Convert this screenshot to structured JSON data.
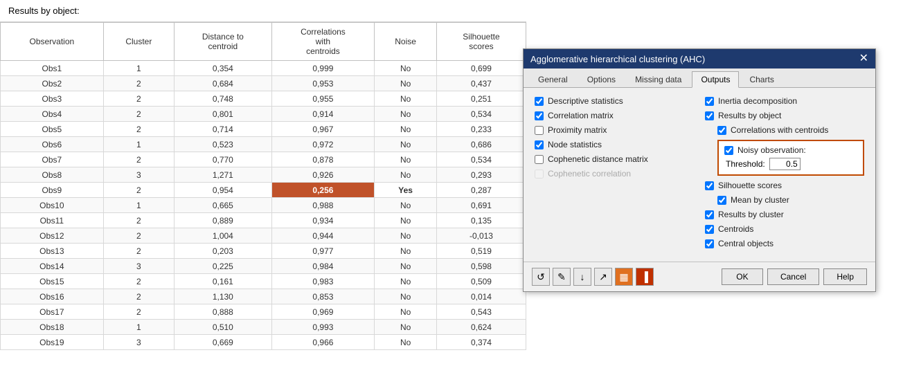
{
  "spreadsheet": {
    "results_label": "Results by object:",
    "columns": [
      "Observation",
      "Cluster",
      "Distance to centroid",
      "Correlations with centroids",
      "Noise",
      "Silhouette scores"
    ],
    "rows": [
      {
        "obs": "Obs1",
        "cluster": "1",
        "dist": "0,354",
        "corr": "0,999",
        "noise": "No",
        "sil": "0,699"
      },
      {
        "obs": "Obs2",
        "cluster": "2",
        "dist": "0,684",
        "corr": "0,953",
        "noise": "No",
        "sil": "0,437"
      },
      {
        "obs": "Obs3",
        "cluster": "2",
        "dist": "0,748",
        "corr": "0,955",
        "noise": "No",
        "sil": "0,251"
      },
      {
        "obs": "Obs4",
        "cluster": "2",
        "dist": "0,801",
        "corr": "0,914",
        "noise": "No",
        "sil": "0,534"
      },
      {
        "obs": "Obs5",
        "cluster": "2",
        "dist": "0,714",
        "corr": "0,967",
        "noise": "No",
        "sil": "0,233"
      },
      {
        "obs": "Obs6",
        "cluster": "1",
        "dist": "0,523",
        "corr": "0,972",
        "noise": "No",
        "sil": "0,686"
      },
      {
        "obs": "Obs7",
        "cluster": "2",
        "dist": "0,770",
        "corr": "0,878",
        "noise": "No",
        "sil": "0,534"
      },
      {
        "obs": "Obs8",
        "cluster": "3",
        "dist": "1,271",
        "corr": "0,926",
        "noise": "No",
        "sil": "0,293"
      },
      {
        "obs": "Obs9",
        "cluster": "2",
        "dist": "0,954",
        "corr": "0,256",
        "noise": "Yes",
        "sil": "0,287",
        "highlight_corr": true
      },
      {
        "obs": "Obs10",
        "cluster": "1",
        "dist": "0,665",
        "corr": "0,988",
        "noise": "No",
        "sil": "0,691"
      },
      {
        "obs": "Obs11",
        "cluster": "2",
        "dist": "0,889",
        "corr": "0,934",
        "noise": "No",
        "sil": "0,135"
      },
      {
        "obs": "Obs12",
        "cluster": "2",
        "dist": "1,004",
        "corr": "0,944",
        "noise": "No",
        "sil": "-0,013"
      },
      {
        "obs": "Obs13",
        "cluster": "2",
        "dist": "0,203",
        "corr": "0,977",
        "noise": "No",
        "sil": "0,519"
      },
      {
        "obs": "Obs14",
        "cluster": "3",
        "dist": "0,225",
        "corr": "0,984",
        "noise": "No",
        "sil": "0,598"
      },
      {
        "obs": "Obs15",
        "cluster": "2",
        "dist": "0,161",
        "corr": "0,983",
        "noise": "No",
        "sil": "0,509"
      },
      {
        "obs": "Obs16",
        "cluster": "2",
        "dist": "1,130",
        "corr": "0,853",
        "noise": "No",
        "sil": "0,014"
      },
      {
        "obs": "Obs17",
        "cluster": "2",
        "dist": "0,888",
        "corr": "0,969",
        "noise": "No",
        "sil": "0,543"
      },
      {
        "obs": "Obs18",
        "cluster": "1",
        "dist": "0,510",
        "corr": "0,993",
        "noise": "No",
        "sil": "0,624"
      },
      {
        "obs": "Obs19",
        "cluster": "3",
        "dist": "0,669",
        "corr": "0,966",
        "noise": "No",
        "sil": "0,374"
      }
    ]
  },
  "dialog": {
    "title": "Agglomerative hierarchical clustering (AHC)",
    "tabs": [
      "General",
      "Options",
      "Missing data",
      "Outputs",
      "Charts"
    ],
    "active_tab": "Outputs",
    "left_column": {
      "items": [
        {
          "label": "Descriptive statistics",
          "checked": true,
          "disabled": false
        },
        {
          "label": "Correlation matrix",
          "checked": true,
          "disabled": false
        },
        {
          "label": "Proximity matrix",
          "checked": false,
          "disabled": false
        },
        {
          "label": "Node statistics",
          "checked": true,
          "disabled": false
        },
        {
          "label": "Cophenetic distance matrix",
          "checked": false,
          "disabled": false
        },
        {
          "label": "Cophenetic correlation",
          "checked": false,
          "disabled": true
        }
      ]
    },
    "right_column": {
      "items_top": [
        {
          "label": "Inertia decomposition",
          "checked": true,
          "disabled": false
        },
        {
          "label": "Results by object",
          "checked": true,
          "disabled": false
        }
      ],
      "correlations_with_centroids": {
        "label": "Correlations with centroids",
        "checked": true,
        "disabled": false
      },
      "noisy_box": {
        "noisy_label": "Noisy observation:",
        "noisy_checked": true,
        "threshold_label": "Threshold:",
        "threshold_value": "0.5"
      },
      "items_bottom": [
        {
          "label": "Silhouette scores",
          "checked": true,
          "disabled": false,
          "indent": false
        },
        {
          "label": "Mean by cluster",
          "checked": true,
          "disabled": false,
          "indent": true
        },
        {
          "label": "Results by cluster",
          "checked": true,
          "disabled": false,
          "indent": false
        },
        {
          "label": "Centroids",
          "checked": true,
          "disabled": false,
          "indent": false
        },
        {
          "label": "Central objects",
          "checked": true,
          "disabled": false,
          "indent": false
        }
      ]
    },
    "footer": {
      "icons": [
        "↺",
        "✎",
        "↓",
        "↗",
        "▦",
        "▐"
      ],
      "ok_label": "OK",
      "cancel_label": "Cancel",
      "help_label": "Help"
    }
  }
}
